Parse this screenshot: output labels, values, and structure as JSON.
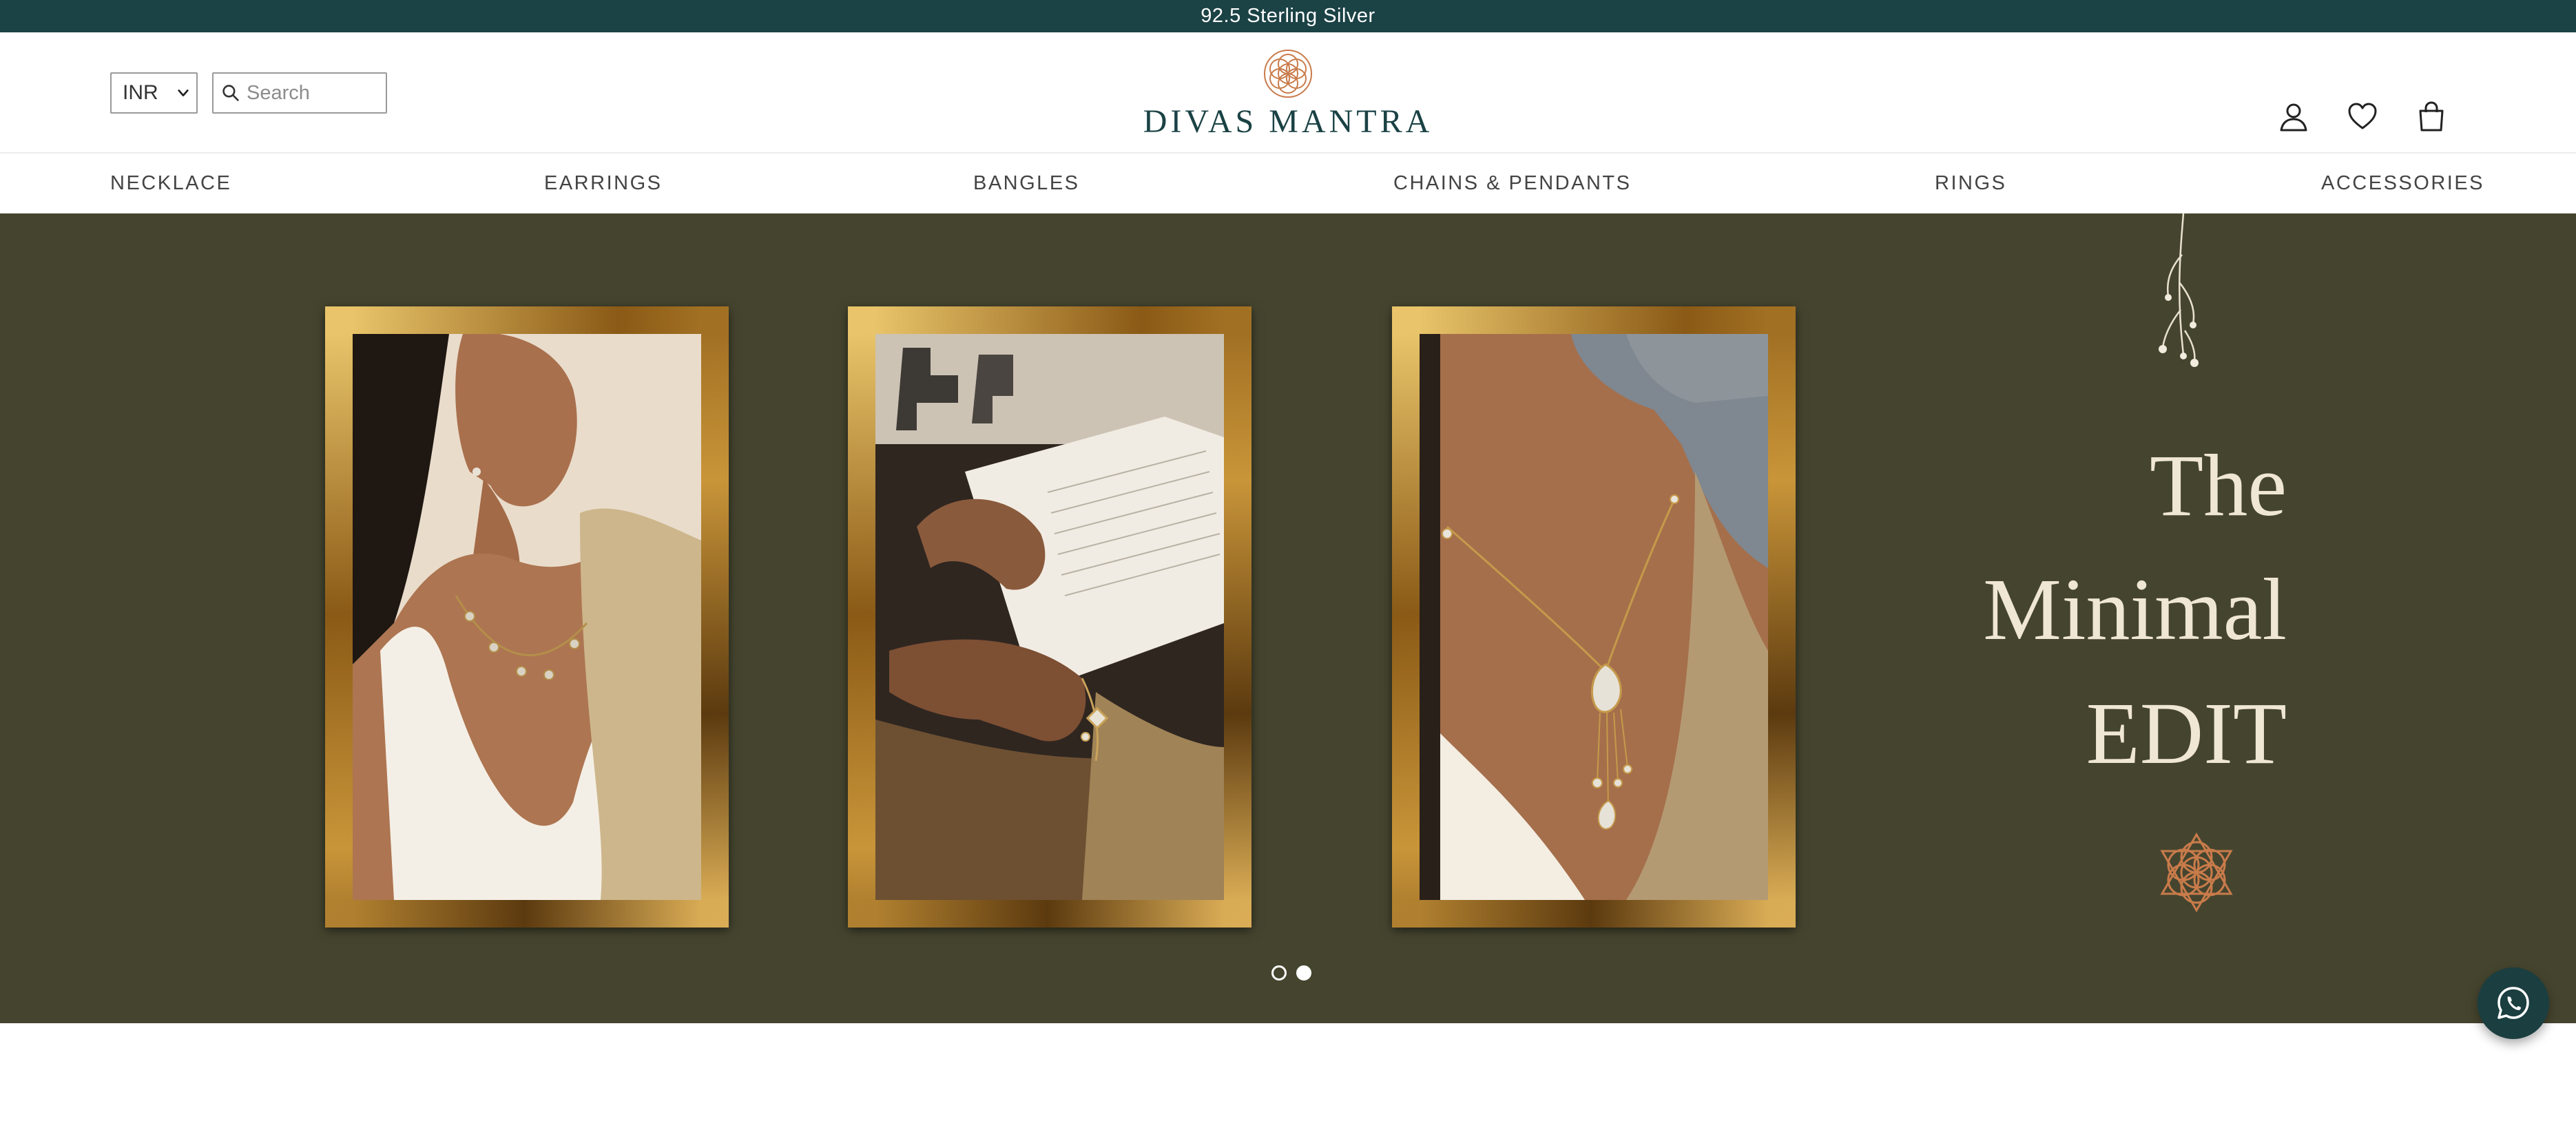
{
  "announcement": {
    "text": "92.5 Sterling Silver"
  },
  "header": {
    "currency": {
      "selected": "INR",
      "options": [
        "INR"
      ]
    },
    "search": {
      "placeholder": "Search",
      "value": ""
    },
    "logo": {
      "text": "DIVAS MANTRA"
    },
    "icons": [
      "user-icon",
      "heart-icon",
      "bag-icon"
    ]
  },
  "nav": {
    "items": [
      {
        "label": "NECKLACE"
      },
      {
        "label": "EARRINGS"
      },
      {
        "label": "BANGLES"
      },
      {
        "label": "CHAINS & PENDANTS"
      },
      {
        "label": "RINGS"
      },
      {
        "label": "ACCESSORIES"
      }
    ]
  },
  "hero": {
    "title_lines": [
      "The",
      "Minimal",
      "EDIT"
    ],
    "slides": {
      "count": 2,
      "active": 2
    }
  },
  "colors": {
    "announcement_bg": "#1b4245",
    "hero_bg": "#45452f",
    "brand_teal": "#1b4245",
    "accent_copper": "#c97b4a",
    "whatsapp_bg": "#1b3e40"
  }
}
